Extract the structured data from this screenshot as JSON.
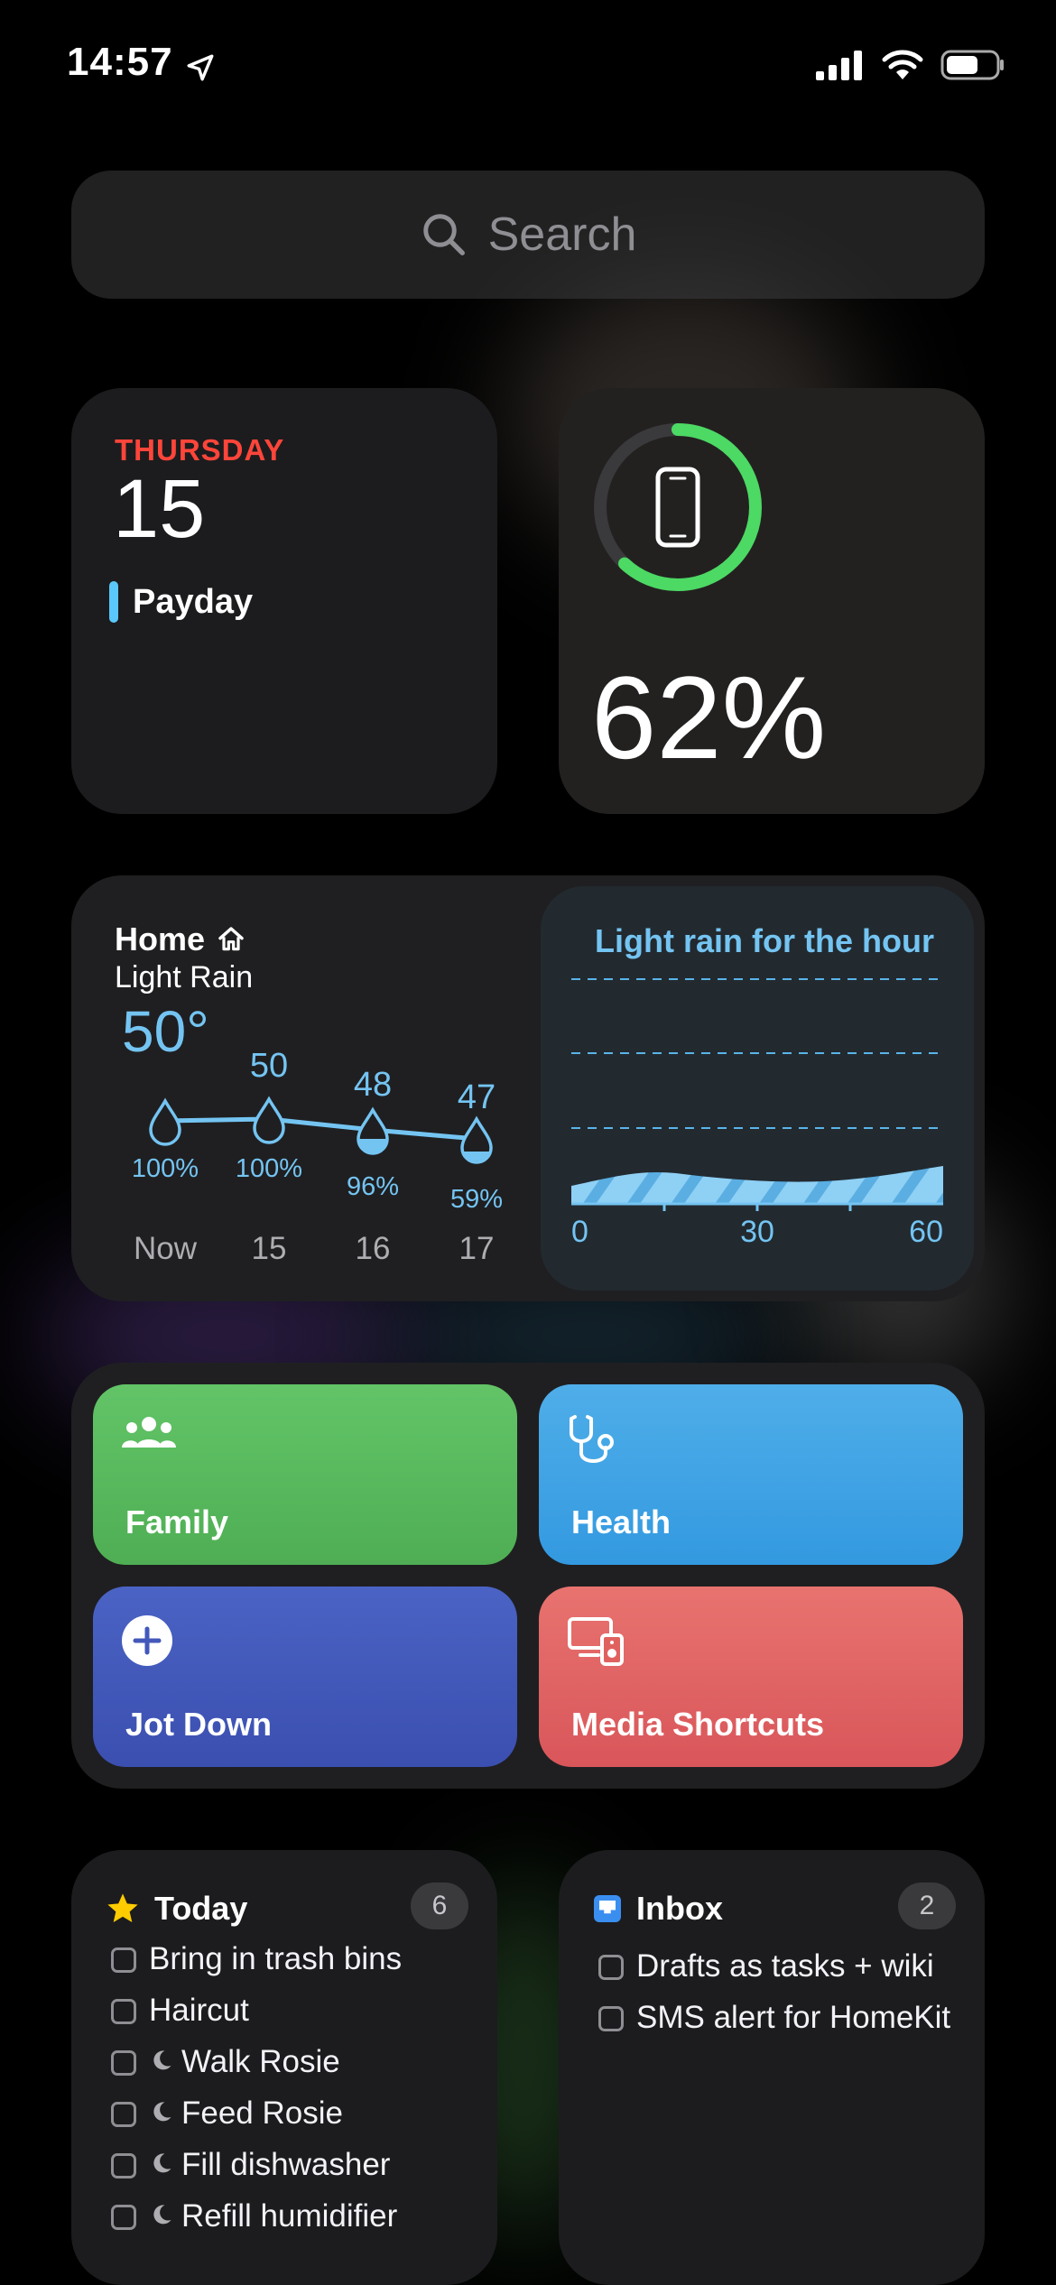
{
  "status_bar": {
    "time": "14:57",
    "battery_level": 0.62
  },
  "search": {
    "placeholder": "Search"
  },
  "calendar": {
    "weekday": "THURSDAY",
    "date": "15",
    "event": "Payday",
    "colors": {
      "weekday": "#ff453a",
      "event_bar": "#5ac8fa"
    }
  },
  "battery": {
    "percent_label": "62%",
    "level": 0.62,
    "device_icon": "iphone-icon",
    "colors": {
      "ring": "#4cd964"
    }
  },
  "weather": {
    "location": "Home",
    "condition": "Light Rain",
    "current_temp": "50°",
    "hours": [
      {
        "label": "Now",
        "temp": "",
        "precip": "100%"
      },
      {
        "label": "15",
        "temp": "50",
        "precip": "100%"
      },
      {
        "label": "16",
        "temp": "48",
        "precip": "96%"
      },
      {
        "label": "17",
        "temp": "47",
        "precip": "59%"
      }
    ],
    "rain_title": "Light rain for the hour",
    "rain_axis": [
      "0",
      "30",
      "60"
    ]
  },
  "shortcuts": {
    "items": [
      {
        "label": "Family",
        "icon": "people-icon",
        "color": "#5bbd60"
      },
      {
        "label": "Health",
        "icon": "stethoscope-icon",
        "color": "#42a4e6"
      },
      {
        "label": "Jot Down",
        "icon": "plus-circle-icon",
        "color": "#4358ba"
      },
      {
        "label": "Media Shortcuts",
        "icon": "devices-icon",
        "color": "#e0625f"
      }
    ]
  },
  "today": {
    "title": "Today",
    "count": "6",
    "tasks": [
      "Bring in trash bins",
      "Haircut",
      "Walk Rosie",
      "Feed Rosie",
      "Fill dishwasher",
      "Refill humidifier"
    ]
  },
  "inbox": {
    "title": "Inbox",
    "count": "2",
    "tasks": [
      "Drafts as tasks + wiki",
      "SMS alert for HomeKit"
    ]
  }
}
